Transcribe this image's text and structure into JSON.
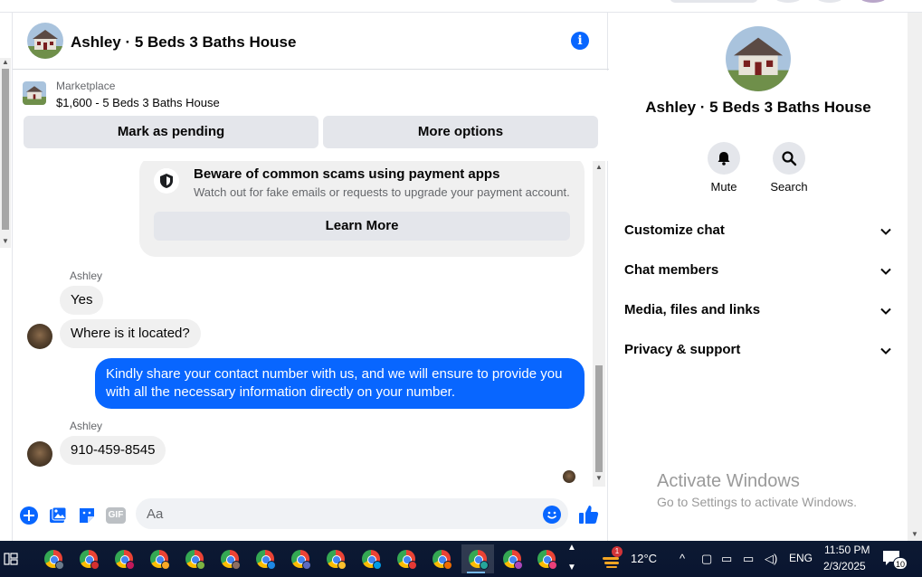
{
  "chat": {
    "title": "Ashley · 5 Beds 3 Baths House",
    "marketplace_label": "Marketplace",
    "product": "$1,600 - 5 Beds 3 Baths House",
    "mark_pending": "Mark as pending",
    "more_options": "More options"
  },
  "scam": {
    "title": "Beware of common scams using payment apps",
    "desc": "Watch out for fake emails or requests to upgrade your payment account.",
    "learn": "Learn More"
  },
  "messages": {
    "sender1": "Ashley",
    "m1": "Yes",
    "m2": "Where is it located?",
    "m3": "Kindly share your contact number with us, and we will ensure to provide you with all the necessary information directly on your number.",
    "sender2": "Ashley",
    "m4": "910-459-8545"
  },
  "composer": {
    "placeholder": "Aa",
    "gif": "GIF"
  },
  "right": {
    "title": "Ashley · 5 Beds 3 Baths House",
    "mute": "Mute",
    "search": "Search",
    "sections": [
      "Customize chat",
      "Chat members",
      "Media, files and links",
      "Privacy & support"
    ]
  },
  "watermark": {
    "line1": "Activate Windows",
    "line2": "Go to Settings to activate Windows."
  },
  "taskbar": {
    "notif_count": "1",
    "temp": "12°C",
    "lang": "ENG",
    "time": "11:50 PM",
    "date": "2/3/2025",
    "notifications": "10"
  },
  "colors": {
    "accent": "#0866ff",
    "bubble": "#f0f0f0"
  }
}
